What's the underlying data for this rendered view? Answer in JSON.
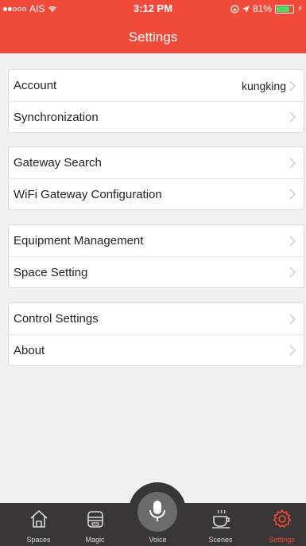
{
  "status": {
    "carrier": "AIS",
    "time": "3:12 PM",
    "battery_pct": "81%",
    "battery_level": 0.81
  },
  "header": {
    "title": "Settings"
  },
  "groups": [
    {
      "rows": [
        {
          "label": "Account",
          "value": "kungking"
        },
        {
          "label": "Synchronization"
        }
      ]
    },
    {
      "rows": [
        {
          "label": "Gateway Search"
        },
        {
          "label": "WiFi Gateway Configuration"
        }
      ]
    },
    {
      "rows": [
        {
          "label": "Equipment Management"
        },
        {
          "label": "Space Setting"
        }
      ]
    },
    {
      "rows": [
        {
          "label": "Control Settings"
        },
        {
          "label": "About"
        }
      ]
    }
  ],
  "tabs": [
    {
      "label": "Spaces",
      "icon": "home-icon"
    },
    {
      "label": "Magic",
      "icon": "magic-box-icon"
    },
    {
      "label": "Voice",
      "icon": "microphone-icon"
    },
    {
      "label": "Scenes",
      "icon": "coffee-cup-icon"
    },
    {
      "label": "Settings",
      "icon": "gear-icon",
      "active": true
    }
  ],
  "colors": {
    "accent": "#f04b3a",
    "tabbar": "#3a3536",
    "background": "#f0f0f0"
  }
}
